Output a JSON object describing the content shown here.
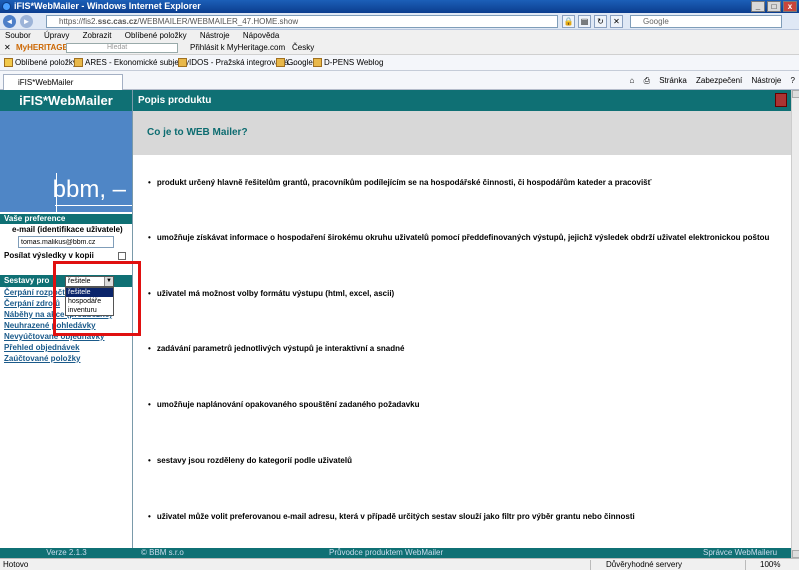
{
  "window": {
    "title": "iFIS*WebMailer - Windows Internet Explorer"
  },
  "address": {
    "url_prefix": "https://fis2.",
    "url_domain": "ssc.cas.cz",
    "url_rest": "/WEBMAILER/WEBMAILER_47.HOME.show",
    "search_placeholder": "Google"
  },
  "menu": [
    "Soubor",
    "Úpravy",
    "Zobrazit",
    "Oblíbené položky",
    "Nástroje",
    "Nápověda"
  ],
  "toolbar2": {
    "brand": "MyHERITAGE",
    "search_placeholder": "Hledat",
    "login": "Přihlásit k MyHeritage.com",
    "language": "Česky"
  },
  "favorites": {
    "label": "Oblíbené položky",
    "items": [
      "ARES - Ekonomické subjekty",
      "IDOS - Pražská integrovaná...",
      "Google",
      "D-PENS Weblog"
    ]
  },
  "tab": {
    "label": "iFIS*WebMailer",
    "tools": [
      "Stránka",
      "Zabezpečení",
      "Nástroje"
    ]
  },
  "left": {
    "app_name": "iFIS*WebMailer",
    "logo_text": "bbm, –",
    "prefs_header": "Vaše preference",
    "email_label": "e-mail (identifikace uživatele)",
    "email_value": "tomas.malikus@bbm.cz",
    "send_copy_label": "Posílat výsledky v kopii",
    "reports_header": "Sestavy pro",
    "links": [
      "Čerpání rozpočtu",
      "Čerpání zdrojů",
      "Náběhy na akce (předběžné)",
      "Neuhrazené pohledávky",
      "Nevyúčtované objednávky",
      "Přehled objednávek",
      "Zaúčtované položky"
    ],
    "version": "Verze 2.1.3"
  },
  "dropdown": {
    "selected": "řešitele",
    "options": [
      "řešitele",
      "hospodáře",
      "inventuru"
    ]
  },
  "main": {
    "header": "Popis produktu",
    "title": "Co je to WEB Mailer?",
    "bullets": [
      "produkt určený hlavně řešitelům grantů, pracovníkům podílejícím se na hospodářské činnosti, či hospodářům kateder a pracovišť",
      "umožňuje získávat informace o hospodaření širokému okruhu uživatelů pomocí předdefinovaných výstupů, jejichž výsledek obdrží uživatel elektronickou poštou",
      "uživatel má možnost volby formátu výstupu (html, excel, ascii)",
      "zadávání parametrů jednotlivých výstupů je interaktivní a snadné",
      "umožňuje naplánování opakovaného spouštění zadaného požadavku",
      "sestavy jsou rozděleny do kategorií podle uživatelů",
      "uživatel může volit preferovanou e-mail adresu, která v případě určitých sestav slouží jako filtr pro výběr grantu nebo činnosti"
    ],
    "footer_copyright": "© BBM s.r.o",
    "footer_guide": "Průvodce produktem WebMailer",
    "footer_admin": "Správce WebMaileru"
  },
  "status": {
    "text": "Hotovo",
    "zone": "Důvěryhodné servery",
    "zoom": "100%"
  }
}
